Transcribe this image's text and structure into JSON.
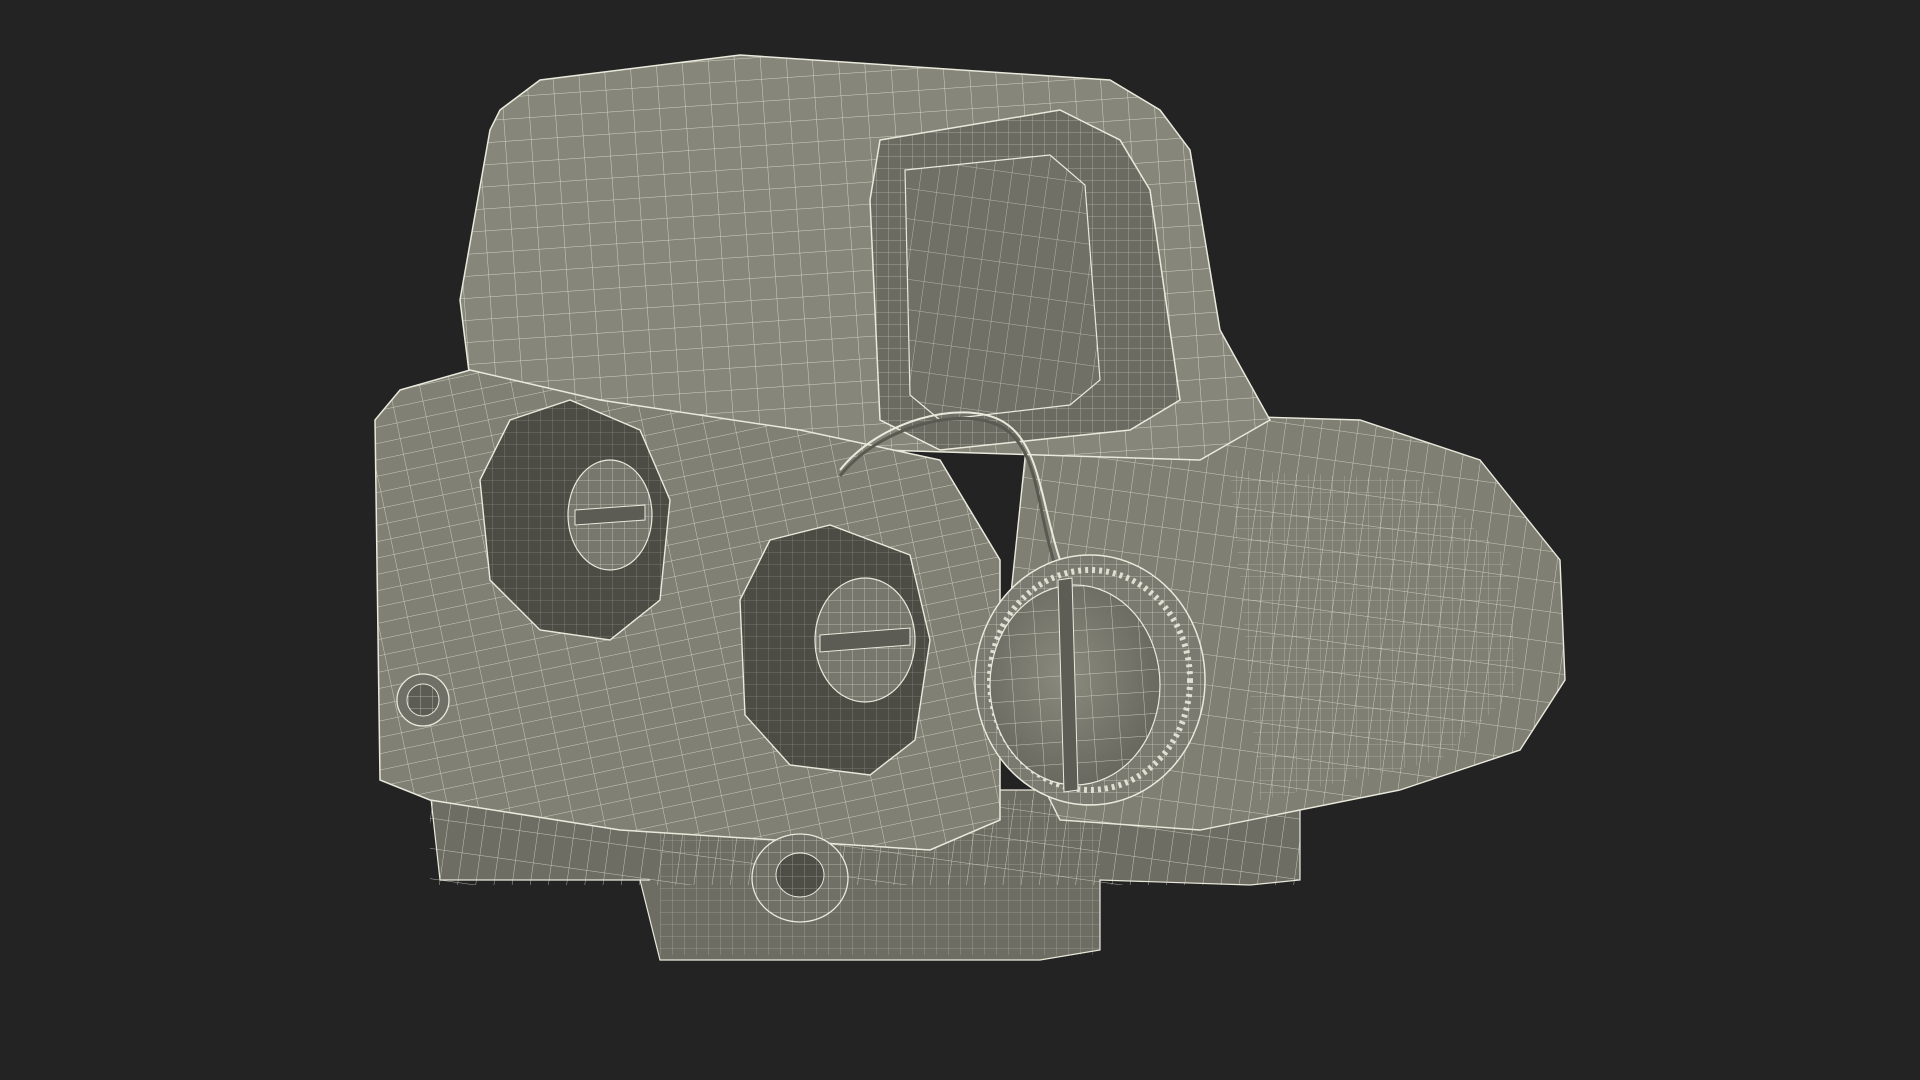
{
  "scene": {
    "subject": "wireframe-render",
    "colors": {
      "background": "#232323",
      "body_fill": "#7d7d72",
      "body_light": "#8c8c80",
      "body_shadow": "#5f5f56",
      "recess": "#4a4a43",
      "wire": "#e9e9dc",
      "window_fill": "#6f6f66"
    },
    "icons": [
      "holographic-sight-model"
    ]
  }
}
